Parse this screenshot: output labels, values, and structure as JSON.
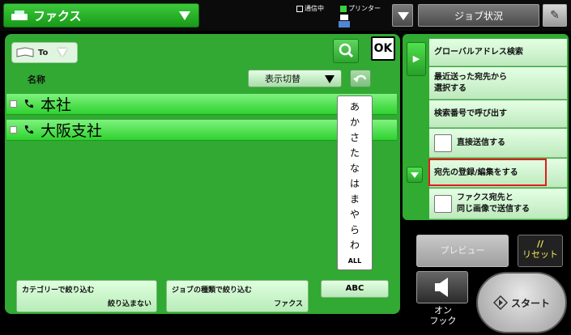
{
  "header": {
    "mode_label": "ファクス",
    "status_comm": "通信中",
    "status_printer": "プリンター",
    "job_status_label": "ジョブ状況"
  },
  "addressbook": {
    "to_label": "To",
    "column_name": "名称",
    "view_toggle_label": "表示切替",
    "ok_label": "OK",
    "entries": [
      {
        "name": "本社"
      },
      {
        "name": "大阪支社"
      }
    ],
    "kana_index": [
      "あ",
      "か",
      "さ",
      "た",
      "な",
      "は",
      "ま",
      "や",
      "ら",
      "わ",
      "ALL"
    ],
    "filters": [
      {
        "title": "カテゴリーで絞り込む",
        "value": "絞り込まない"
      },
      {
        "title": "ジョブの種類で絞り込む",
        "value": "ファクス"
      }
    ],
    "abc_label": "ABC"
  },
  "side_menu": {
    "items": [
      {
        "label": "グローバルアドレス検索"
      },
      {
        "label": "最近送った宛先から\n選択する"
      },
      {
        "label": "検索番号で呼び出す"
      },
      {
        "label": "直接送信する"
      },
      {
        "label": "宛先の登録/編集をする"
      },
      {
        "label": "ファクス宛先と\n同じ画像で送信する"
      }
    ]
  },
  "controls": {
    "preview_label": "プレビュー",
    "reset_label": "リセット",
    "onhook_label": "オン\nフック",
    "start_label": "スタート"
  },
  "colors": {
    "accent": "#31a933",
    "highlight": "#e31b1b"
  }
}
